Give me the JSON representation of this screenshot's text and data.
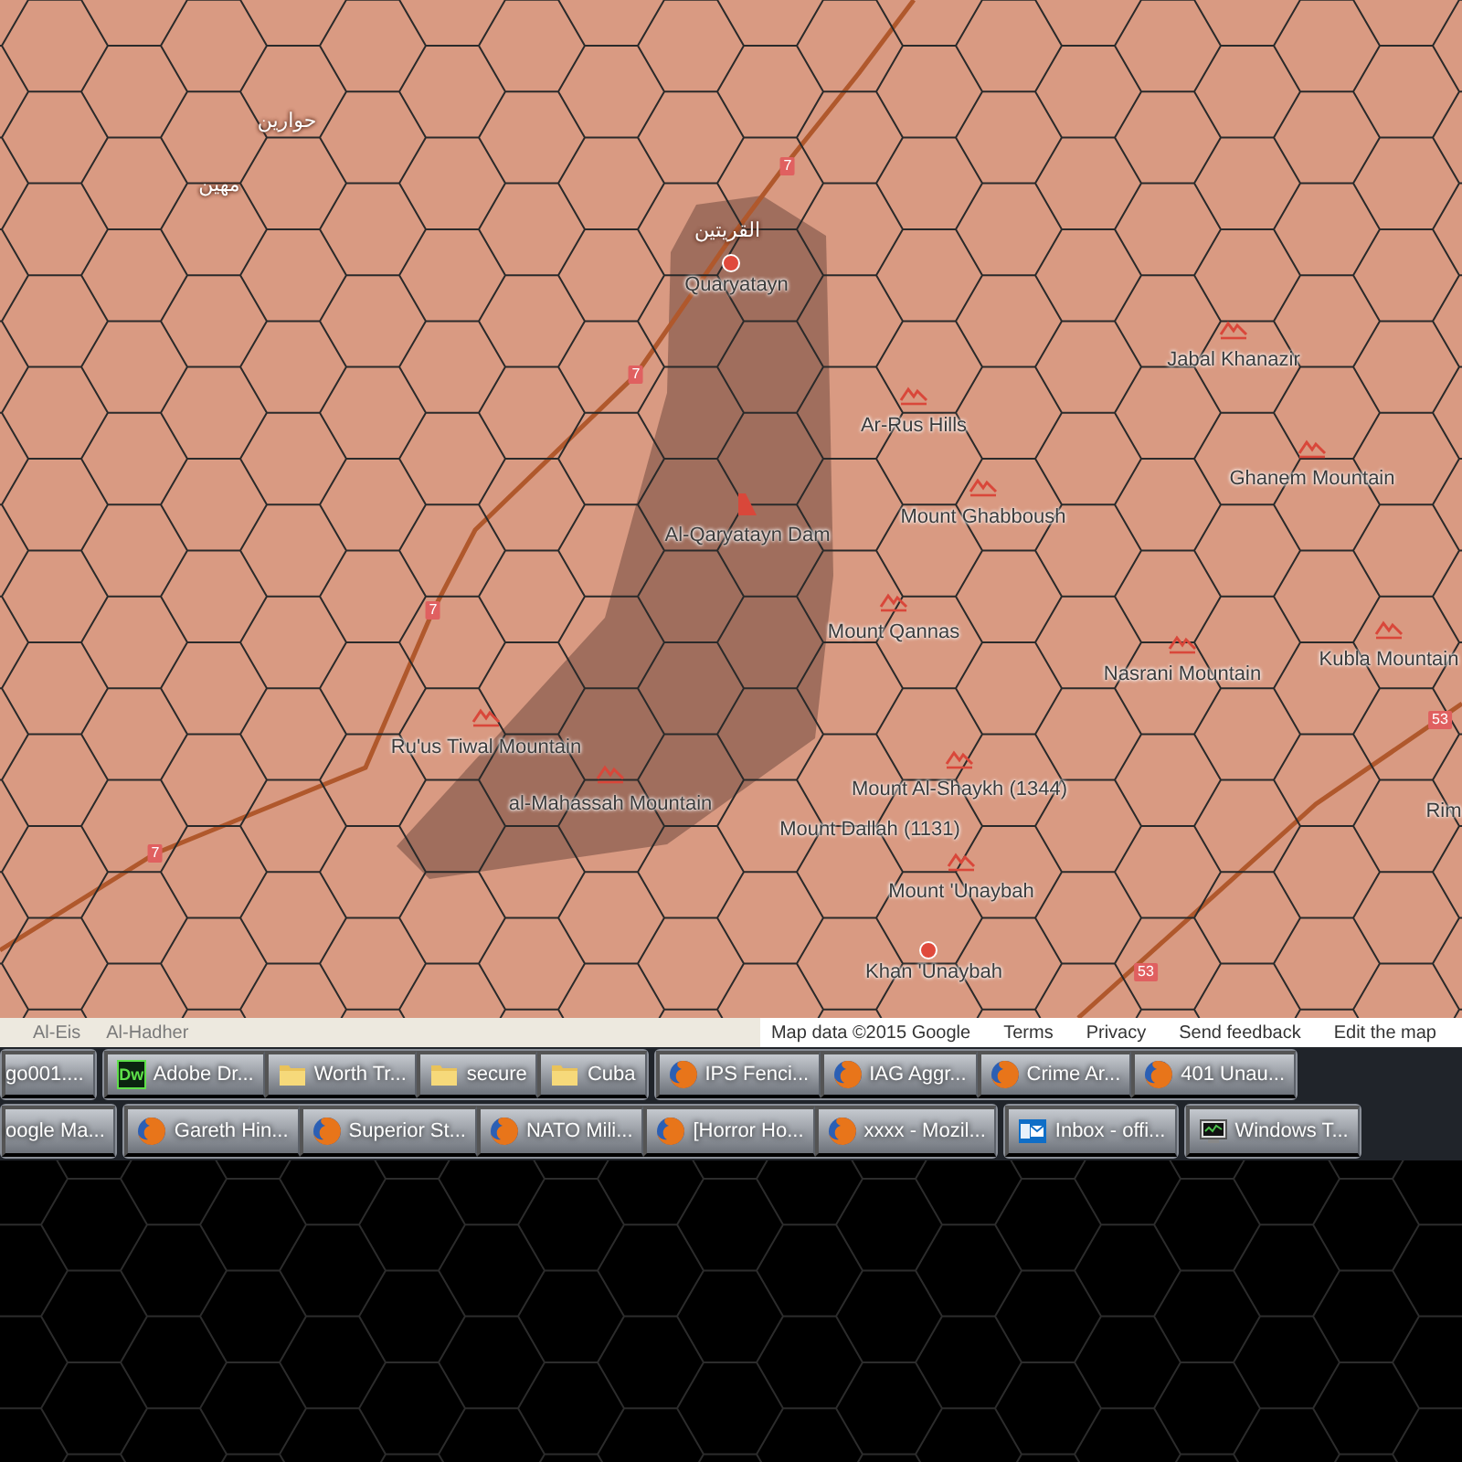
{
  "map": {
    "labels": [
      {
        "text": "حوارين",
        "kind": "arabic"
      },
      {
        "text": "مهين",
        "kind": "arabic"
      },
      {
        "text": "القريتين",
        "kind": "arabic"
      },
      {
        "text": "Quaryatayn",
        "kind": "town"
      },
      {
        "text": "Jabal Khanazir",
        "kind": "mountain"
      },
      {
        "text": "Ar-Rus Hills",
        "kind": "mountain"
      },
      {
        "text": "Ghanem Mountain",
        "kind": "mountain"
      },
      {
        "text": "Mount Ghabboush",
        "kind": "mountain"
      },
      {
        "text": "Al-Qaryatayn Dam",
        "kind": "dam"
      },
      {
        "text": "Mount Qannas",
        "kind": "mountain"
      },
      {
        "text": "Kubla Mountain",
        "kind": "mountain"
      },
      {
        "text": "Nasrani Mountain",
        "kind": "mountain"
      },
      {
        "text": "Ru'us Tiwal Mountain",
        "kind": "mountain"
      },
      {
        "text": "Mount Al-Shaykh (1344)",
        "kind": "mountain"
      },
      {
        "text": "al-Mahassah Mountain",
        "kind": "mountain"
      },
      {
        "text": "Rim",
        "kind": "place"
      },
      {
        "text": "Mount Dallah (1131)",
        "kind": "place"
      },
      {
        "text": "Mount 'Unaybah",
        "kind": "mountain"
      },
      {
        "text": "Khan 'Unaybah",
        "kind": "town"
      }
    ],
    "road_shields": [
      {
        "text": "7"
      },
      {
        "text": "7"
      },
      {
        "text": "7"
      },
      {
        "text": "7"
      },
      {
        "text": "53"
      },
      {
        "text": "53"
      }
    ]
  },
  "map_footer": {
    "places": [
      "Al-Eis",
      "Al-Hadher"
    ],
    "links": [
      "Map data ©2015 Google",
      "Terms",
      "Privacy",
      "Send feedback",
      "Edit the map"
    ]
  },
  "taskbar": {
    "rows": [
      {
        "groups": [
          {
            "buttons": [
              {
                "label": "go001....",
                "kind": "plain"
              }
            ]
          },
          {
            "buttons": [
              {
                "label": "Adobe Dr...",
                "kind": "app",
                "icon_text": "Dw"
              },
              {
                "label": "Worth Tr...",
                "kind": "folder"
              },
              {
                "label": "secure",
                "kind": "folder"
              },
              {
                "label": "Cuba",
                "kind": "folder"
              }
            ]
          },
          {
            "buttons": [
              {
                "label": "IPS Fenci...",
                "kind": "browser"
              },
              {
                "label": "IAG Aggr...",
                "kind": "browser"
              },
              {
                "label": "Crime Ar...",
                "kind": "browser"
              },
              {
                "label": "401 Unau...",
                "kind": "browser"
              }
            ]
          }
        ]
      },
      {
        "groups": [
          {
            "buttons": [
              {
                "label": "oogle Ma...",
                "kind": "plain"
              }
            ]
          },
          {
            "buttons": [
              {
                "label": "Gareth Hin...",
                "kind": "browser"
              },
              {
                "label": "Superior St...",
                "kind": "browser"
              },
              {
                "label": "NATO Mili...",
                "kind": "browser"
              },
              {
                "label": "[Horror Ho...",
                "kind": "browser"
              },
              {
                "label": "xxxx - Mozil...",
                "kind": "browser"
              }
            ]
          },
          {
            "buttons": [
              {
                "label": "Inbox - offi...",
                "kind": "mail"
              }
            ]
          },
          {
            "buttons": [
              {
                "label": "Windows T...",
                "kind": "monitor"
              }
            ]
          }
        ]
      }
    ]
  }
}
